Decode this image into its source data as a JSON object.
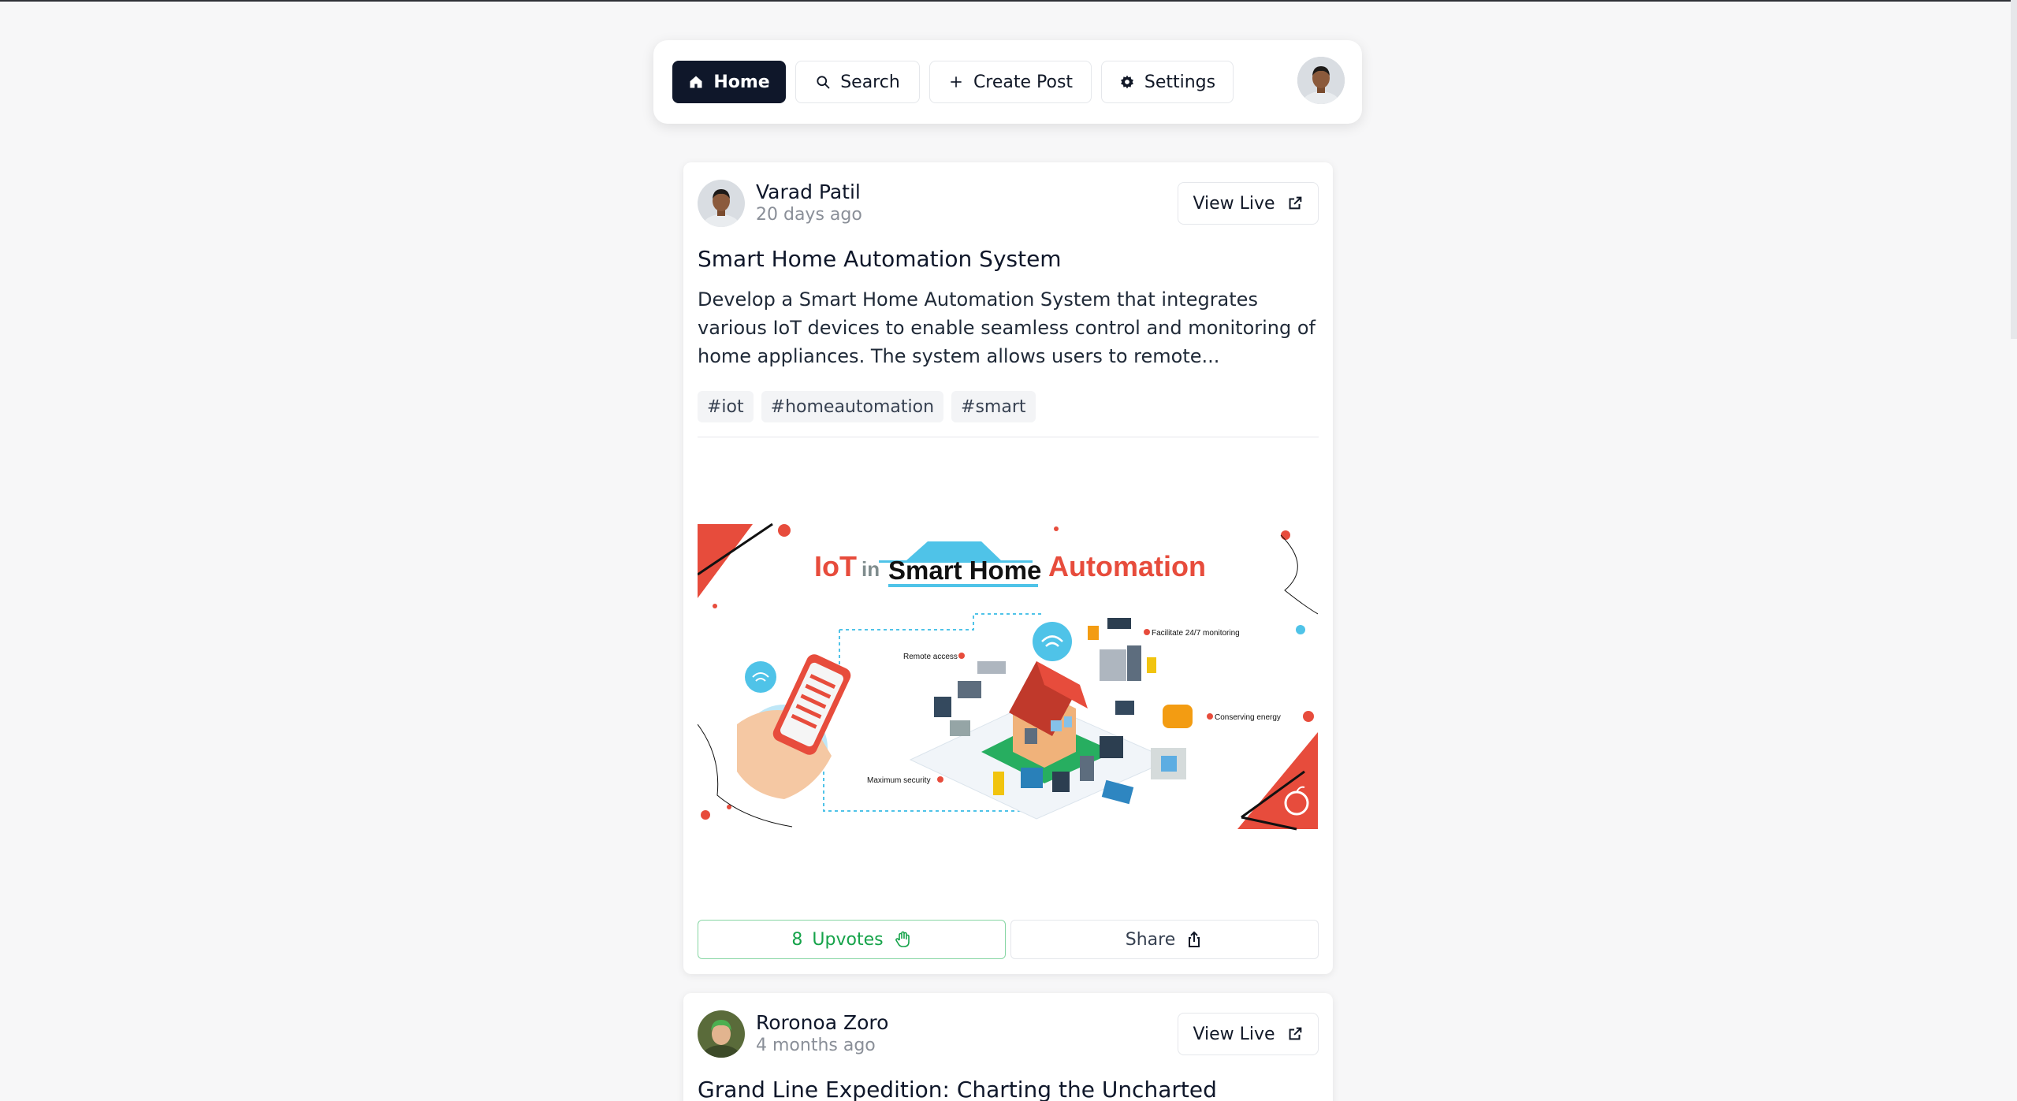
{
  "nav": {
    "home": "Home",
    "search": "Search",
    "create_post": "Create Post",
    "settings": "Settings"
  },
  "posts": [
    {
      "author": "Varad Patil",
      "time": "20 days ago",
      "view_live": "View Live",
      "title": "Smart Home Automation System",
      "description": "Develop a Smart Home Automation System that integrates various IoT devices to enable seamless control and monitoring of home appliances. The system allows users to remote...",
      "tags": [
        "#iot",
        "#homeautomation",
        "#smart"
      ],
      "image": {
        "title_part1": "IoT",
        "title_part2": "in",
        "title_part3": "Smart Home",
        "title_part4": "Automation",
        "labels": {
          "monitoring": "Facilitate 24/7 monitoring",
          "remote": "Remote access",
          "energy": "Conserving energy",
          "security": "Maximum security"
        }
      },
      "upvotes": "8",
      "upvotes_label": "Upvotes",
      "share_label": "Share"
    },
    {
      "author": "Roronoa Zoro",
      "time": "4 months ago",
      "view_live": "View Live",
      "title": "Grand Line Expedition: Charting the Uncharted"
    }
  ],
  "colors": {
    "primary_dark": "#0f172a",
    "upvote_green": "#16a34a",
    "accent_red": "#e74c3c",
    "accent_blue": "#4fc3e8"
  }
}
